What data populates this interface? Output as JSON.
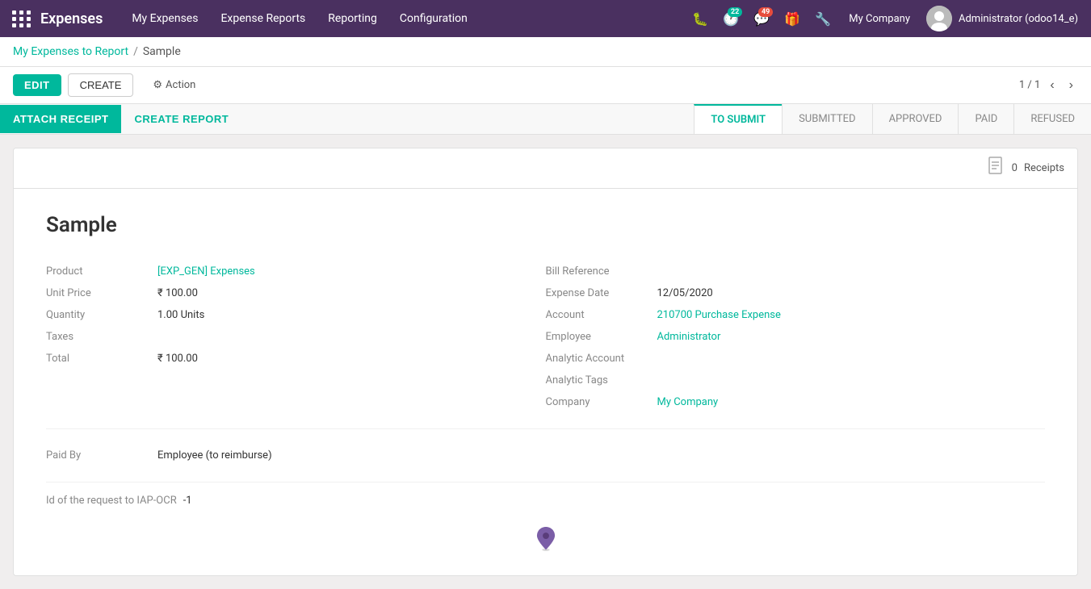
{
  "topnav": {
    "app_title": "Expenses",
    "menu_items": [
      "My Expenses",
      "Expense Reports",
      "Reporting",
      "Configuration"
    ],
    "badge_22": "22",
    "badge_49": "49",
    "company": "My Company",
    "username": "Administrator (odoo14_e)"
  },
  "breadcrumb": {
    "parent_label": "My Expenses to Report",
    "separator": "/",
    "current": "Sample"
  },
  "action_bar": {
    "edit_label": "EDIT",
    "create_label": "CREATE",
    "action_label": "Action",
    "pagination": "1 / 1"
  },
  "status_bar": {
    "attach_receipt_label": "ATTACH RECEIPT",
    "create_report_label": "CREATE REPORT",
    "stages": [
      "TO SUBMIT",
      "SUBMITTED",
      "APPROVED",
      "PAID",
      "REFUSED"
    ],
    "active_stage": "TO SUBMIT"
  },
  "card": {
    "receipts_count": "0",
    "receipts_label": "Receipts"
  },
  "record": {
    "title": "Sample",
    "fields_left": {
      "product_label": "Product",
      "product_value": "[EXP_GEN] Expenses",
      "unit_price_label": "Unit Price",
      "unit_price_value": "₹ 100.00",
      "quantity_label": "Quantity",
      "quantity_value": "1.00 Units",
      "taxes_label": "Taxes",
      "total_label": "Total",
      "total_value": "₹ 100.00"
    },
    "fields_right": {
      "bill_reference_label": "Bill Reference",
      "expense_date_label": "Expense Date",
      "expense_date_value": "12/05/2020",
      "account_label": "Account",
      "account_value": "210700 Purchase Expense",
      "employee_label": "Employee",
      "employee_value": "Administrator",
      "analytic_account_label": "Analytic Account",
      "analytic_tags_label": "Analytic Tags",
      "company_label": "Company",
      "company_value": "My Company"
    },
    "paid_by_label": "Paid By",
    "paid_by_value": "Employee (to reimburse)",
    "iap_label": "Id of the request to IAP-OCR",
    "iap_value": "-1"
  }
}
